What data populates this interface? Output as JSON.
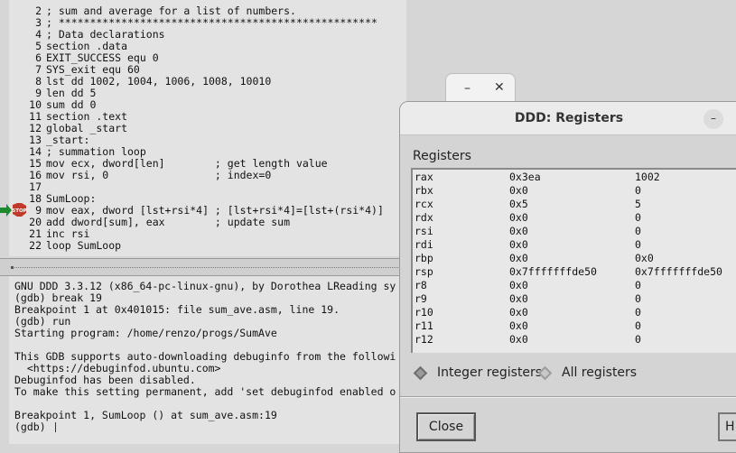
{
  "source": {
    "lines": [
      {
        "n": "2",
        "code": "; sum and average for a list of numbers."
      },
      {
        "n": "3",
        "code": "; ***************************************************"
      },
      {
        "n": "4",
        "code": "; Data declarations"
      },
      {
        "n": "5",
        "code": "section .data"
      },
      {
        "n": "6",
        "code": "EXIT_SUCCESS equ 0"
      },
      {
        "n": "7",
        "code": "SYS_exit equ 60"
      },
      {
        "n": "8",
        "code": "lst dd 1002, 1004, 1006, 1008, 10010"
      },
      {
        "n": "9",
        "code": "len dd 5"
      },
      {
        "n": "10",
        "code": "sum dd 0"
      },
      {
        "n": "11",
        "code": "section .text"
      },
      {
        "n": "12",
        "code": "global _start"
      },
      {
        "n": "13",
        "code": "_start:"
      },
      {
        "n": "14",
        "code": "; summation loop"
      },
      {
        "n": "15",
        "code": "mov ecx, dword[len]        ; get length value"
      },
      {
        "n": "16",
        "code": "mov rsi, 0                 ; index=0"
      },
      {
        "n": "17",
        "code": ""
      },
      {
        "n": "18",
        "code": "SumLoop:"
      },
      {
        "n": "9",
        "code": "mov eax, dword [lst+rsi*4] ; [lst+rsi*4]=[lst+(rsi*4)]"
      },
      {
        "n": "20",
        "code": "add dword[sum], eax        ; update sum"
      },
      {
        "n": "21",
        "code": "inc rsi"
      },
      {
        "n": "22",
        "code": "loop SumLoop"
      }
    ],
    "breakpoint_label": "STOP"
  },
  "console": {
    "lines": [
      "GNU DDD 3.3.12 (x86_64-pc-linux-gnu), by Dorothea LReading sy",
      "(gdb) break 19",
      "Breakpoint 1 at 0x401015: file sum_ave.asm, line 19.",
      "(gdb) run",
      "Starting program: /home/renzo/progs/SumAve",
      "",
      "This GDB supports auto-downloading debuginfo from the followi",
      "  <https://debuginfod.ubuntu.com>",
      "Debuginfod has been disabled.",
      "To make this setting permanent, add 'set debuginfod enabled o",
      "",
      "Breakpoint 1, SumLoop () at sum_ave.asm:19",
      "(gdb) "
    ]
  },
  "mini_window": {
    "minimize": "–",
    "close": "✕"
  },
  "registers_dialog": {
    "title": "DDD: Registers",
    "minimize": "–",
    "label": "Registers",
    "rows": [
      {
        "name": "rax",
        "hex": "0x3ea",
        "natural": "1002"
      },
      {
        "name": "rbx",
        "hex": "0x0",
        "natural": "0"
      },
      {
        "name": "rcx",
        "hex": "0x5",
        "natural": "5"
      },
      {
        "name": "rdx",
        "hex": "0x0",
        "natural": "0"
      },
      {
        "name": "rsi",
        "hex": "0x0",
        "natural": "0"
      },
      {
        "name": "rdi",
        "hex": "0x0",
        "natural": "0"
      },
      {
        "name": "rbp",
        "hex": "0x0",
        "natural": "0x0"
      },
      {
        "name": "rsp",
        "hex": "0x7fffffffde50",
        "natural": "0x7fffffffde50"
      },
      {
        "name": "r8",
        "hex": "0x0",
        "natural": "0"
      },
      {
        "name": "r9",
        "hex": "0x0",
        "natural": "0"
      },
      {
        "name": "r10",
        "hex": "0x0",
        "natural": "0"
      },
      {
        "name": "r11",
        "hex": "0x0",
        "natural": "0"
      },
      {
        "name": "r12",
        "hex": "0x0",
        "natural": "0"
      }
    ],
    "radio_integer": "Integer registers",
    "radio_all": "All registers",
    "selected": "integer",
    "close_label": "Close",
    "help_label": "H"
  },
  "colors": {
    "breakpoint": "#c0392b",
    "execution_arrow": "#1e8a2e"
  }
}
